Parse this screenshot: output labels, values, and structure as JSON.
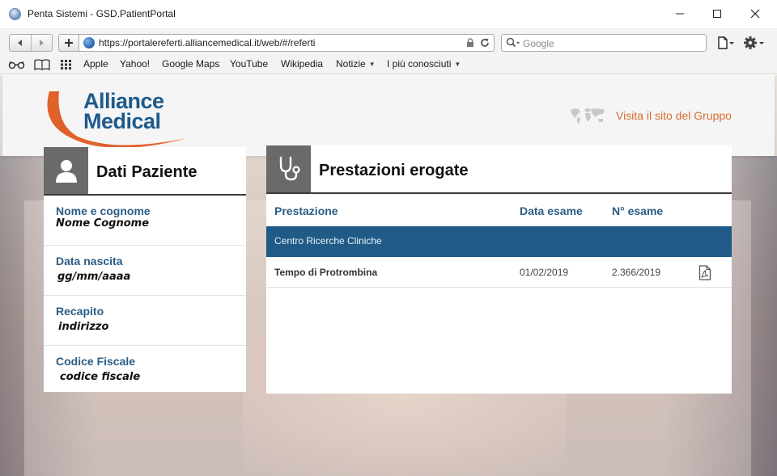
{
  "window": {
    "title": "Penta Sistemi - GSD.PatientPortal"
  },
  "toolbar": {
    "url": "https://portalereferti.alliancemedical.it/web/#/referti",
    "search_placeholder": "Google"
  },
  "bookmarks": [
    {
      "label": "Apple"
    },
    {
      "label": "Yahoo!"
    },
    {
      "label": "Google Maps"
    },
    {
      "label": "YouTube"
    },
    {
      "label": "Wikipedia"
    },
    {
      "label": "Notizie",
      "dropdown": true
    },
    {
      "label": "I più conosciuti",
      "dropdown": true
    }
  ],
  "header": {
    "logo_line1": "Alliance",
    "logo_line2": "Medical",
    "visit_link": "Visita il sito del Gruppo"
  },
  "patient": {
    "title": "Dati Paziente",
    "fields": [
      {
        "label": "Nome e cognome",
        "value": "Nome Cognome"
      },
      {
        "label": "Data nascita",
        "value": "gg/mm/aaaa"
      },
      {
        "label": "Recapito",
        "value": "indirizzo"
      },
      {
        "label": "Codice Fiscale",
        "value": "codice fiscale"
      }
    ]
  },
  "services": {
    "title": "Prestazioni erogate",
    "columns": [
      "Prestazione",
      "Data esame",
      "N° esame"
    ],
    "group": "Centro Ricerche Cliniche",
    "rows": [
      {
        "prestazione": "Tempo di Protrombina",
        "data": "01/02/2019",
        "numero": "2.366/2019"
      }
    ]
  },
  "colors": {
    "brand_blue": "#1e5a8c",
    "brand_orange": "#e0622a",
    "group_row": "#1f5b86",
    "link_orange": "#d96b2e"
  }
}
